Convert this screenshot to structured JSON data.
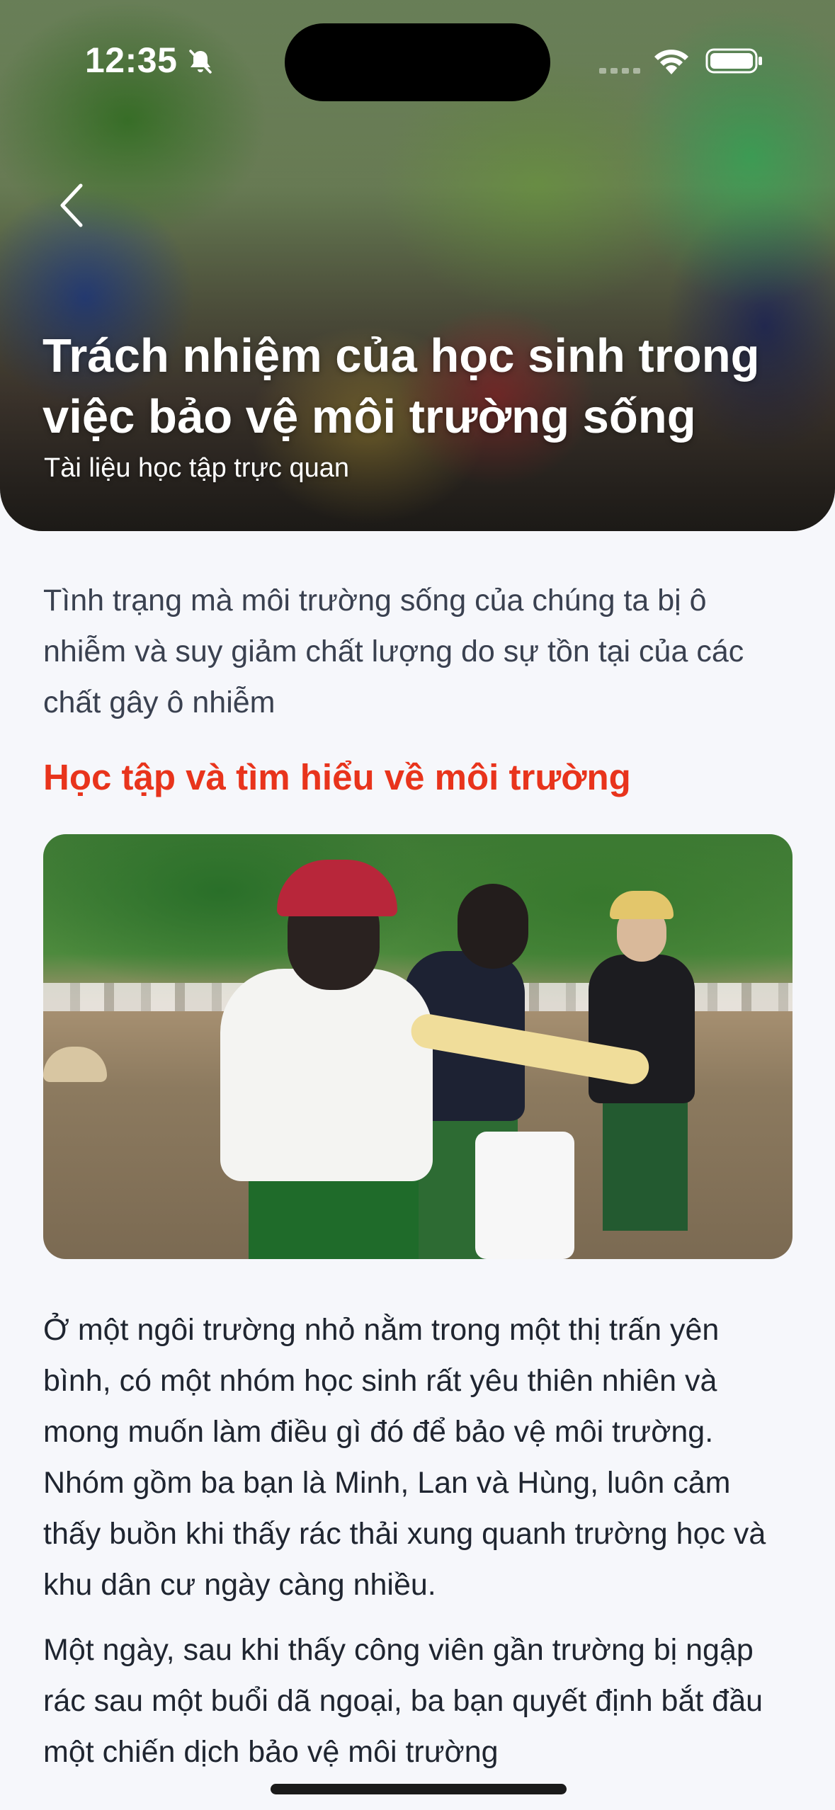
{
  "status_bar": {
    "time": "12:35",
    "silent_icon": "bell-slash-icon",
    "signal_icon": "cellular-signal-icon",
    "wifi_icon": "wifi-icon",
    "battery_icon": "battery-icon"
  },
  "hero": {
    "back_icon": "chevron-left-icon",
    "title": "Trách nhiệm của học sinh trong việc bảo vệ môi trường sống",
    "subtitle": "Tài liệu học tập trực quan"
  },
  "article": {
    "intro": "Tình trạng mà môi trường sống của chúng ta bị ô nhiễm và suy giảm chất lượng do sự tồn tại của các chất gây ô nhiễm",
    "section_heading": "Học tập và tìm hiểu về môi trường",
    "section_heading_color": "#e8341c",
    "paragraphs": [
      "Ở một ngôi trường nhỏ nằm trong một thị trấn yên bình, có một nhóm học sinh rất yêu thiên nhiên và mong muốn làm điều gì đó để bảo vệ môi trường. Nhóm gồm ba bạn là Minh, Lan và Hùng, luôn cảm thấy buồn khi thấy rác thải xung quanh trường học và khu dân cư ngày càng nhiều.",
      "Một ngày, sau khi thấy công viên gần trường bị ngập rác sau một buổi dã ngoại, ba bạn quyết định bắt đầu một chiến dịch bảo vệ môi trường"
    ]
  }
}
